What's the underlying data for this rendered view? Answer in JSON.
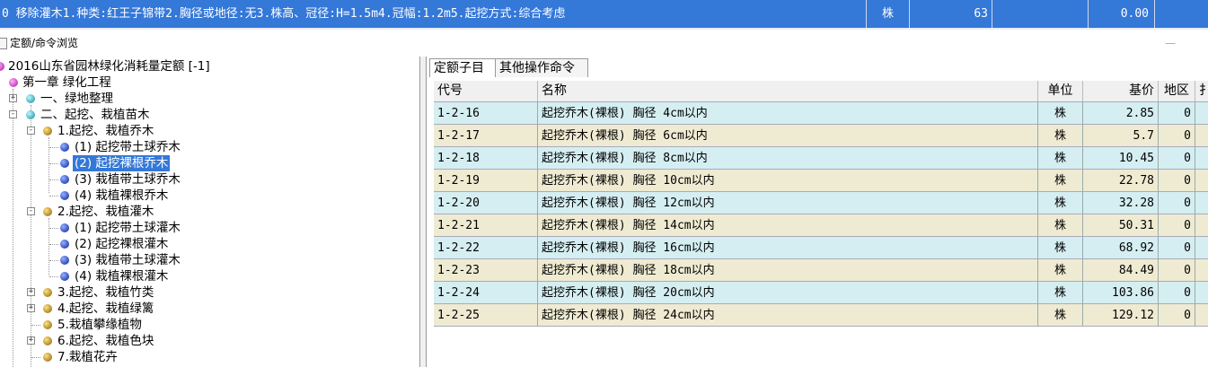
{
  "selected_row": {
    "index": "0",
    "description": "移除灌木1.种类:红王子锦带2.胸径或地径:无3.株高、冠径:H=1.5m4.冠幅:1.2m5.起挖方式:综合考虑",
    "unit": "株",
    "quantity": "63",
    "price": "0.00"
  },
  "panel": {
    "title": "定额/命令浏览",
    "dash": "—"
  },
  "tree": {
    "root": "2016山东省园林绿化消耗量定额 [-1]",
    "chapter": "第一章  绿化工程",
    "nodes": [
      "一、绿地整理",
      "二、起挖、栽植苗木",
      "1.起挖、栽植乔木",
      "(1) 起挖带土球乔木",
      "(2) 起挖裸根乔木",
      "(3) 栽植带土球乔木",
      "(4) 栽植裸根乔木",
      "2.起挖、栽植灌木",
      "(1) 起挖带土球灌木",
      "(2) 起挖裸根灌木",
      "(3) 栽植带土球灌木",
      "(4) 栽植裸根灌木",
      "3.起挖、栽植竹类",
      "4.起挖、栽植绿篱",
      "5.栽植攀缘植物",
      "6.起挖、栽植色块",
      "7.栽植花卉"
    ]
  },
  "tabs": [
    "定额子目",
    "其他操作命令"
  ],
  "table": {
    "headers": [
      "代号",
      "名称",
      "单位",
      "基价",
      "地区",
      "扌"
    ],
    "rows": [
      [
        "1-2-16",
        "起挖乔木(裸根) 胸径 4cm以内",
        "株",
        "2.85",
        "0"
      ],
      [
        "1-2-17",
        "起挖乔木(裸根) 胸径 6cm以内",
        "株",
        "5.7",
        "0"
      ],
      [
        "1-2-18",
        "起挖乔木(裸根) 胸径 8cm以内",
        "株",
        "10.45",
        "0"
      ],
      [
        "1-2-19",
        "起挖乔木(裸根) 胸径 10cm以内",
        "株",
        "22.78",
        "0"
      ],
      [
        "1-2-20",
        "起挖乔木(裸根) 胸径 12cm以内",
        "株",
        "32.28",
        "0"
      ],
      [
        "1-2-21",
        "起挖乔木(裸根) 胸径 14cm以内",
        "株",
        "50.31",
        "0"
      ],
      [
        "1-2-22",
        "起挖乔木(裸根) 胸径 16cm以内",
        "株",
        "68.92",
        "0"
      ],
      [
        "1-2-23",
        "起挖乔木(裸根) 胸径 18cm以内",
        "株",
        "84.49",
        "0"
      ],
      [
        "1-2-24",
        "起挖乔木(裸根) 胸径 20cm以内",
        "株",
        "103.86",
        "0"
      ],
      [
        "1-2-25",
        "起挖乔木(裸根) 胸径 24cm以内",
        "株",
        "129.12",
        "0"
      ]
    ]
  }
}
